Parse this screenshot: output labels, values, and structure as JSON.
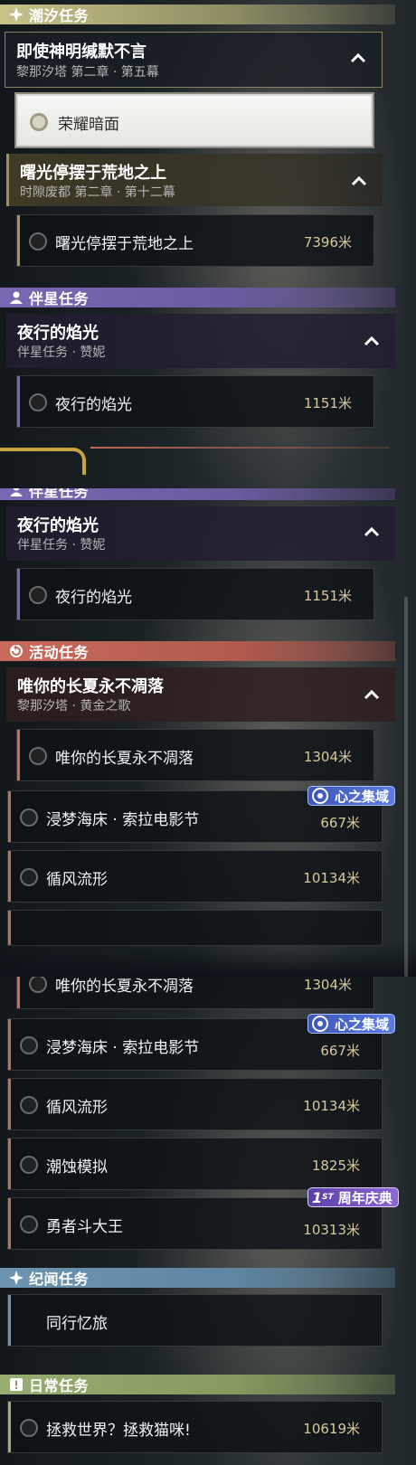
{
  "s1": {
    "tide_label": "潮汐任务",
    "q1": {
      "title": "即使神明缄默不言",
      "sub": "黎那汐塔 第二章 · 第五幕"
    },
    "q1_item": "荣耀暗面",
    "q2": {
      "title": "曙光停摆于荒地之上",
      "sub": "时隙废都 第二章 · 第十二幕"
    },
    "q2_item": {
      "name": "曙光停摆于荒地之上",
      "dist": "7396米"
    },
    "comp_label": "伴星任务",
    "q3": {
      "title": "夜行的焰光",
      "sub": "伴星任务 · 赞妮"
    },
    "q3_item": {
      "name": "夜行的焰光",
      "dist": "1151米"
    }
  },
  "s2": {
    "comp_label": "伴星任务",
    "q1": {
      "title": "夜行的焰光",
      "sub": "伴星任务 · 赞妮"
    },
    "q1_item": {
      "name": "夜行的焰光",
      "dist": "1151米"
    },
    "evt_label": "活动任务",
    "q2": {
      "title": "唯你的长夏永不凋落",
      "sub": "黎那汐塔 · 黄金之歌"
    },
    "q2_item": {
      "name": "唯你的长夏永不凋落",
      "dist": "1304米"
    },
    "badge_heart": "心之集域",
    "items": [
      {
        "name": "浸梦海床 · 索拉电影节",
        "dist": "667米"
      },
      {
        "name": "循风流形",
        "dist": "10134米"
      }
    ]
  },
  "s3": {
    "top_item": {
      "name": "唯你的长夏永不凋落",
      "dist": "1304米"
    },
    "badge_heart": "心之集域",
    "items": [
      {
        "name": "浸梦海床 · 索拉电影节",
        "dist": "667米"
      },
      {
        "name": "循风流形",
        "dist": "10134米"
      },
      {
        "name": "潮蚀模拟",
        "dist": "1825米"
      },
      {
        "name": "勇者斗大王",
        "dist": "10313米"
      }
    ],
    "badge_anni_prefix": "1",
    "badge_anni_st": "ST",
    "badge_anni": "周年庆典",
    "chr_label": "纪闻任务",
    "chr_item": {
      "name": "同行忆旅"
    },
    "day_label": "日常任务",
    "day_item": {
      "name": "拯救世界？拯救猫咪!",
      "dist": "10619米"
    }
  },
  "colors": {
    "tide": "#c8c38a",
    "companion": "#7a67b3",
    "event": "#c86a5c",
    "chronicle": "#6d94b0",
    "daily": "#98ad72",
    "distance": "#d8c99c"
  }
}
